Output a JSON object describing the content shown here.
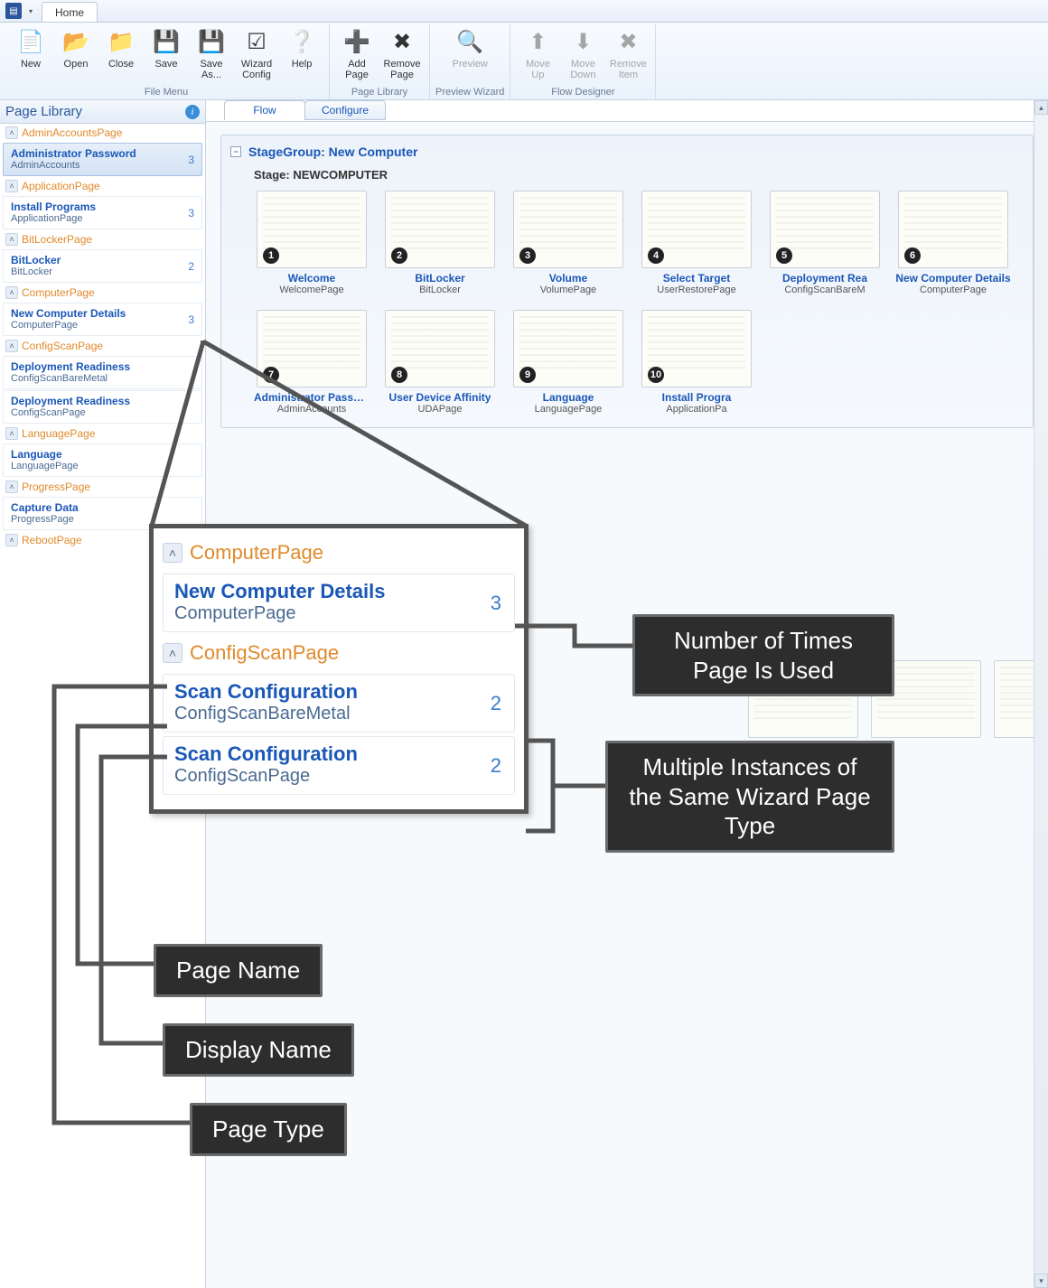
{
  "titlebar": {
    "tab_home": "Home"
  },
  "ribbon": {
    "groups": [
      {
        "label": "File Menu",
        "buttons": [
          {
            "id": "new",
            "label": "New",
            "icon": "📄"
          },
          {
            "id": "open",
            "label": "Open",
            "icon": "📂"
          },
          {
            "id": "close",
            "label": "Close",
            "icon": "📁"
          },
          {
            "id": "save",
            "label": "Save",
            "icon": "💾"
          },
          {
            "id": "saveas",
            "label": "Save As...",
            "icon": "💾"
          },
          {
            "id": "wizcfg",
            "label": "Wizard Config",
            "icon": "☑"
          },
          {
            "id": "help",
            "label": "Help",
            "icon": "❔"
          }
        ]
      },
      {
        "label": "Page Library",
        "buttons": [
          {
            "id": "addpage",
            "label": "Add Page",
            "icon": "➕"
          },
          {
            "id": "removepage",
            "label": "Remove Page",
            "icon": "✖"
          }
        ]
      },
      {
        "label": "Preview Wizard",
        "buttons": [
          {
            "id": "preview",
            "label": "Preview",
            "icon": "🔍",
            "disabled": true
          }
        ]
      },
      {
        "label": "Flow Designer",
        "buttons": [
          {
            "id": "moveup",
            "label": "Move Up",
            "icon": "⬆",
            "disabled": true
          },
          {
            "id": "movedown",
            "label": "Move Down",
            "icon": "⬇",
            "disabled": true
          },
          {
            "id": "removeitem",
            "label": "Remove Item",
            "icon": "✖",
            "disabled": true
          }
        ]
      }
    ]
  },
  "left_panel": {
    "title": "Page Library",
    "groups": [
      {
        "name": "AdminAccountsPage",
        "items": [
          {
            "name": "Administrator Password",
            "sub": "AdminAccounts",
            "count": "3",
            "selected": true
          }
        ]
      },
      {
        "name": "ApplicationPage",
        "items": [
          {
            "name": "Install Programs",
            "sub": "ApplicationPage",
            "count": "3"
          }
        ]
      },
      {
        "name": "BitLockerPage",
        "items": [
          {
            "name": "BitLocker",
            "sub": "BitLocker",
            "count": "2"
          }
        ]
      },
      {
        "name": "ComputerPage",
        "items": [
          {
            "name": "New Computer Details",
            "sub": "ComputerPage",
            "count": "3"
          }
        ]
      },
      {
        "name": "ConfigScanPage",
        "items": [
          {
            "name": "Deployment Readiness",
            "sub": "ConfigScanBareMetal",
            "count": ""
          },
          {
            "name": "Deployment Readiness",
            "sub": "ConfigScanPage",
            "count": ""
          }
        ]
      },
      {
        "name": "LanguagePage",
        "items": [
          {
            "name": "Language",
            "sub": "LanguagePage",
            "count": ""
          }
        ]
      },
      {
        "name": "ProgressPage",
        "items": [
          {
            "name": "Capture Data",
            "sub": "ProgressPage",
            "count": ""
          }
        ]
      },
      {
        "name": "RebootPage",
        "items": []
      }
    ]
  },
  "tabs": {
    "flow": "Flow",
    "configure": "Configure"
  },
  "stagegroup": {
    "title": "StageGroup: New Computer",
    "stage_label": "Stage: NEWCOMPUTER",
    "pages": [
      {
        "n": "1",
        "title": "Welcome",
        "sub": "WelcomePage"
      },
      {
        "n": "2",
        "title": "BitLocker",
        "sub": "BitLocker"
      },
      {
        "n": "3",
        "title": "Volume",
        "sub": "VolumePage"
      },
      {
        "n": "4",
        "title": "Select Target",
        "sub": "UserRestorePage"
      },
      {
        "n": "5",
        "title": "Deployment Rea",
        "sub": "ConfigScanBareM"
      },
      {
        "n": "6",
        "title": "New Computer Details",
        "sub": "ComputerPage"
      },
      {
        "n": "7",
        "title": "Administrator Passw...",
        "sub": "AdminAccounts"
      },
      {
        "n": "8",
        "title": "User Device Affinity",
        "sub": "UDAPage"
      },
      {
        "n": "9",
        "title": "Language",
        "sub": "LanguagePage"
      },
      {
        "n": "10",
        "title": "Install Progra",
        "sub": "ApplicationPa"
      }
    ]
  },
  "callout": {
    "groups": [
      {
        "name": "ComputerPage",
        "items": [
          {
            "name": "New Computer Details",
            "sub": "ComputerPage",
            "count": "3"
          }
        ]
      },
      {
        "name": "ConfigScanPage",
        "items": [
          {
            "name": "Scan Configuration",
            "sub": "ConfigScanBareMetal",
            "count": "2"
          },
          {
            "name": "Scan Configuration",
            "sub": "ConfigScanPage",
            "count": "2"
          }
        ]
      }
    ]
  },
  "annotations": {
    "count": "Number of Times Page Is Used",
    "multi": "Multiple Instances of the Same Wizard Page Type",
    "pagename": "Page Name",
    "displayname": "Display Name",
    "pagetype": "Page Type"
  }
}
